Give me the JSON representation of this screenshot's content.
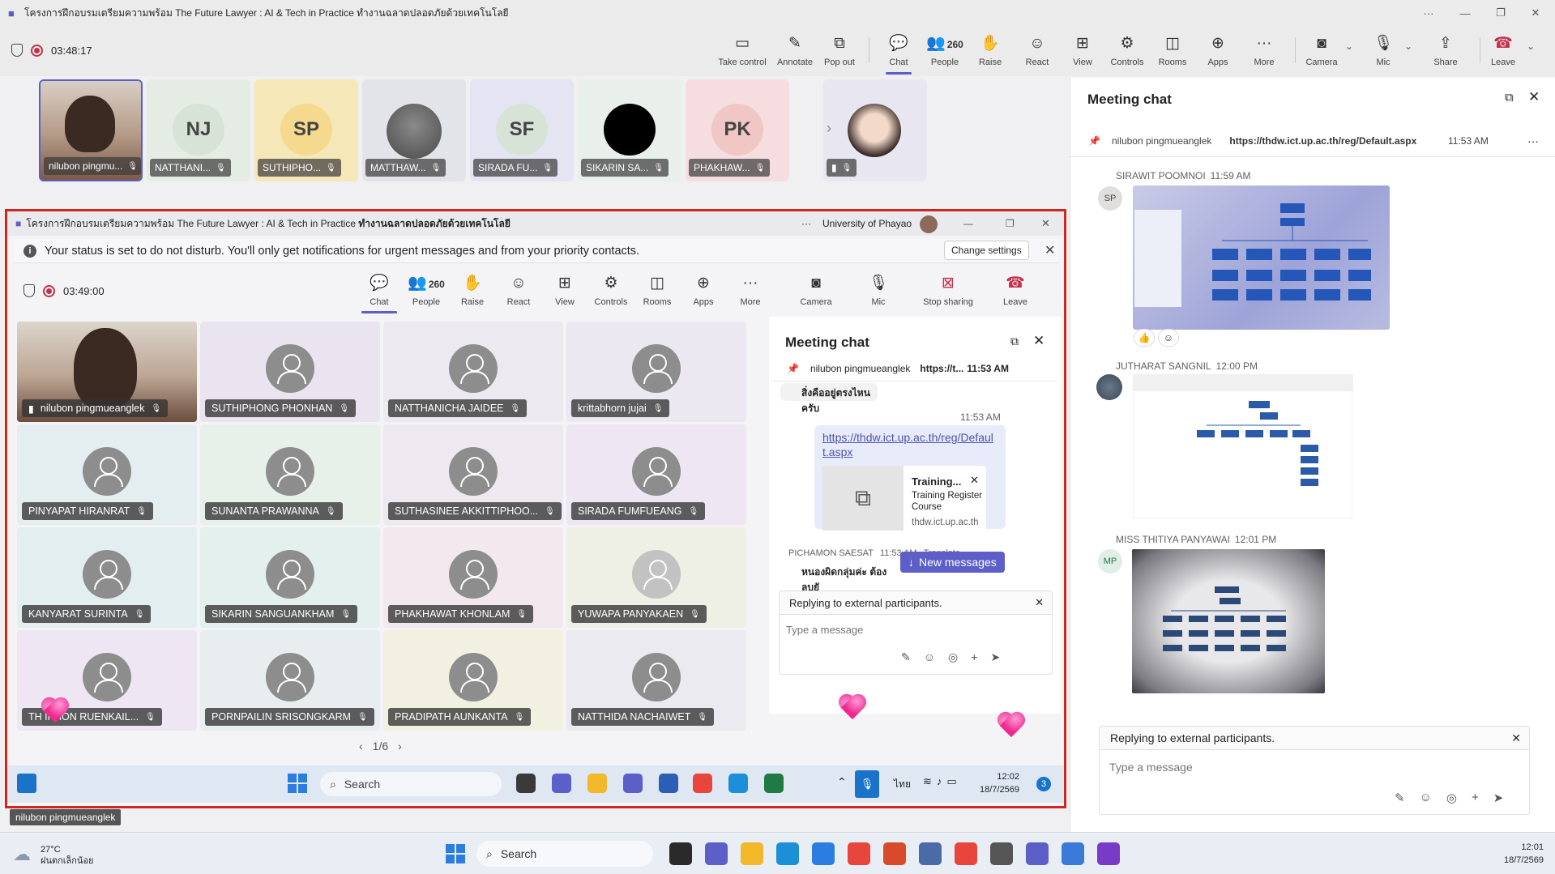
{
  "window": {
    "title": "โครงการฝึกอบรมเตรียมความพร้อม The Future Lawyer : AI & Tech in Practice ทำงานฉลาดปลอดภัยด้วยเทคโนโลยี"
  },
  "toolbar": {
    "timer": "03:48:17",
    "buttons": [
      {
        "id": "take-control",
        "label": "Take control",
        "icon": "monitor-icon"
      },
      {
        "id": "annotate",
        "label": "Annotate",
        "icon": "pen-icon"
      },
      {
        "id": "pop-out",
        "label": "Pop out",
        "icon": "pop-out-icon"
      },
      {
        "id": "chat",
        "label": "Chat",
        "icon": "chat-icon"
      },
      {
        "id": "people",
        "label": "People",
        "icon": "people-icon",
        "count": "260"
      },
      {
        "id": "raise",
        "label": "Raise",
        "icon": "hand-icon"
      },
      {
        "id": "react",
        "label": "React",
        "icon": "smiley-icon"
      },
      {
        "id": "view",
        "label": "View",
        "icon": "view-icon"
      },
      {
        "id": "controls",
        "label": "Controls",
        "icon": "controls-icon"
      },
      {
        "id": "rooms",
        "label": "Rooms",
        "icon": "rooms-icon"
      },
      {
        "id": "apps",
        "label": "Apps",
        "icon": "plus-icon"
      },
      {
        "id": "more",
        "label": "More",
        "icon": "more-icon"
      },
      {
        "id": "camera",
        "label": "Camera",
        "icon": "camera-off-icon"
      },
      {
        "id": "mic",
        "label": "Mic",
        "icon": "mic-off-icon"
      },
      {
        "id": "share",
        "label": "Share",
        "icon": "share-icon"
      },
      {
        "id": "leave",
        "label": "Leave",
        "icon": "phone-icon"
      }
    ]
  },
  "filmstrip": [
    {
      "name": "nilubon pingmu...",
      "kind": "video",
      "color": "#c9b8a6"
    },
    {
      "name": "NATTHANI...",
      "initials": "NJ",
      "color": "#e4ece4"
    },
    {
      "name": "SUTHIPHO...",
      "initials": "SP",
      "color": "#f6e7b8"
    },
    {
      "name": "MATTHAW...",
      "kind": "cat",
      "color": "#e3e3ea"
    },
    {
      "name": "SIRADA FU...",
      "initials": "SF",
      "color": "#e4e4f2"
    },
    {
      "name": "SIKARIN SA...",
      "kind": "black",
      "color": "#e9f0ec"
    },
    {
      "name": "PHAKHAW...",
      "initials": "PK",
      "color": "#f5dde0"
    },
    {
      "name": "",
      "kind": "woman",
      "color": "#e8e6f0"
    }
  ],
  "shared": {
    "title_prefix": "โครงการฝึกอบรมเตรียมความพร้อม The Future Lawyer : AI & Tech in Practice",
    "title_suffix": "ทำงานฉลาดปลอดภัยด้วยเทคโนโลยี",
    "org": "University of Phayao",
    "dnd_text": "Your status is set to do not disturb. You'll only get notifications for urgent messages and from your priority contacts.",
    "change_settings": "Change settings",
    "timer": "03:49:00",
    "toolbar": [
      {
        "label": "Chat",
        "icon": "chat-icon"
      },
      {
        "label": "People",
        "icon": "people-icon",
        "count": "260"
      },
      {
        "label": "Raise",
        "icon": "hand-icon"
      },
      {
        "label": "React",
        "icon": "smiley-icon"
      },
      {
        "label": "View",
        "icon": "view-icon"
      },
      {
        "label": "Controls",
        "icon": "controls-icon"
      },
      {
        "label": "Rooms",
        "icon": "rooms-icon"
      },
      {
        "label": "Apps",
        "icon": "plus-icon"
      },
      {
        "label": "More",
        "icon": "more-icon"
      },
      {
        "label": "Camera",
        "icon": "camera-icon"
      },
      {
        "label": "Mic",
        "icon": "mic-icon"
      },
      {
        "label": "Stop sharing",
        "icon": "stop-share-icon"
      },
      {
        "label": "Leave",
        "icon": "phone-icon"
      }
    ],
    "grid": [
      {
        "name": "nilubon pingmueanglek",
        "video": true,
        "color": "#c9b8a6"
      },
      {
        "name": "SUTHIPHONG PHONHAN",
        "color": "#eae4f0"
      },
      {
        "name": "NATTHANICHA JAIDEE",
        "color": "#eceaf0"
      },
      {
        "name": "krittabhorn jujai",
        "color": "#ece8f2"
      },
      {
        "name": "PINYAPAT HIRANRAT",
        "color": "#e4eef0"
      },
      {
        "name": "SUNANTA PRAWANNA",
        "color": "#e8f0ea"
      },
      {
        "name": "SUTHASINEE AKKITTIPHOO...",
        "color": "#eee8f0"
      },
      {
        "name": "SIRADA FUMFUEANG",
        "color": "#eee6f2"
      },
      {
        "name": "KANYARAT SURINTA",
        "color": "#e2eef0"
      },
      {
        "name": "SIKARIN SANGUANKHAM",
        "color": "#e4f0ee"
      },
      {
        "name": "PHAKHAWAT KHONLAM",
        "color": "#f2e8ee"
      },
      {
        "name": "YUWAPA PANYAKAEN",
        "color": "#eef0e6"
      },
      {
        "name": "TH    IPHON RUENKAIL...",
        "color": "#eee6f2"
      },
      {
        "name": "PORNPAILIN SRISONGKARM",
        "color": "#e8eef0"
      },
      {
        "name": "PRADIPATH AUNKANTA",
        "color": "#f2f0e0"
      },
      {
        "name": "NATTHIDA NACHAIWET",
        "color": "#eaeaf0"
      }
    ],
    "pager": "1/6",
    "chat": {
      "title": "Meeting chat",
      "pinned_sender": "nilubon pingmueanglek",
      "pinned_link": "https://t...",
      "pinned_time": "11:53 AM",
      "prev_snippet": "สิ่งคืออยู่ตรงไหนครับ",
      "msg_time": "11:53 AM",
      "link": "https://thdw.ict.up.ac.th/reg/Default.aspx",
      "card_title": "Training...",
      "card_desc": "Training Register Course",
      "card_domain": "thdw.ict.up.ac.th",
      "next_sender": "PICHAMON SAESAT",
      "next_time": "11:53 AM",
      "translate": "Translate",
      "next_snippet": "หนองผิดกลุ่มค่ะ ต้องลบยั",
      "new_messages": "New messages",
      "replying": "Replying to external participants.",
      "placeholder": "Type a message"
    },
    "taskbar": {
      "search": "Search",
      "lang": "ไทย",
      "time": "12:02",
      "date": "18/7/2569",
      "notif": "3"
    }
  },
  "presenter_label": "nilubon pingmueanglek",
  "chat_panel": {
    "title": "Meeting chat",
    "pinned_sender": "nilubon pingmueanglek",
    "pinned_link": "https://thdw.ict.up.ac.th/reg/Default.aspx",
    "pinned_time": "11:53 AM",
    "messages": [
      {
        "sender": "SIRAWIT POOMNOI",
        "time": "11:59 AM",
        "initials": "SP"
      },
      {
        "sender": "JUTHARAT SANGNIL",
        "time": "12:00 PM"
      },
      {
        "sender": "MISS THITIYA PANYAWAI",
        "time": "12:01 PM",
        "initials": "MP"
      }
    ],
    "replying": "Replying to external participants.",
    "placeholder": "Type a message"
  },
  "taskbar": {
    "weather_temp": "27°C",
    "weather_desc": "ฝนตกเล็กน้อย",
    "search": "Search",
    "time": "12:01",
    "date": "18/7/2569"
  },
  "colors": {
    "accent": "#5b5fc7",
    "leave": "#c4314b",
    "share_border": "#d1261f"
  }
}
